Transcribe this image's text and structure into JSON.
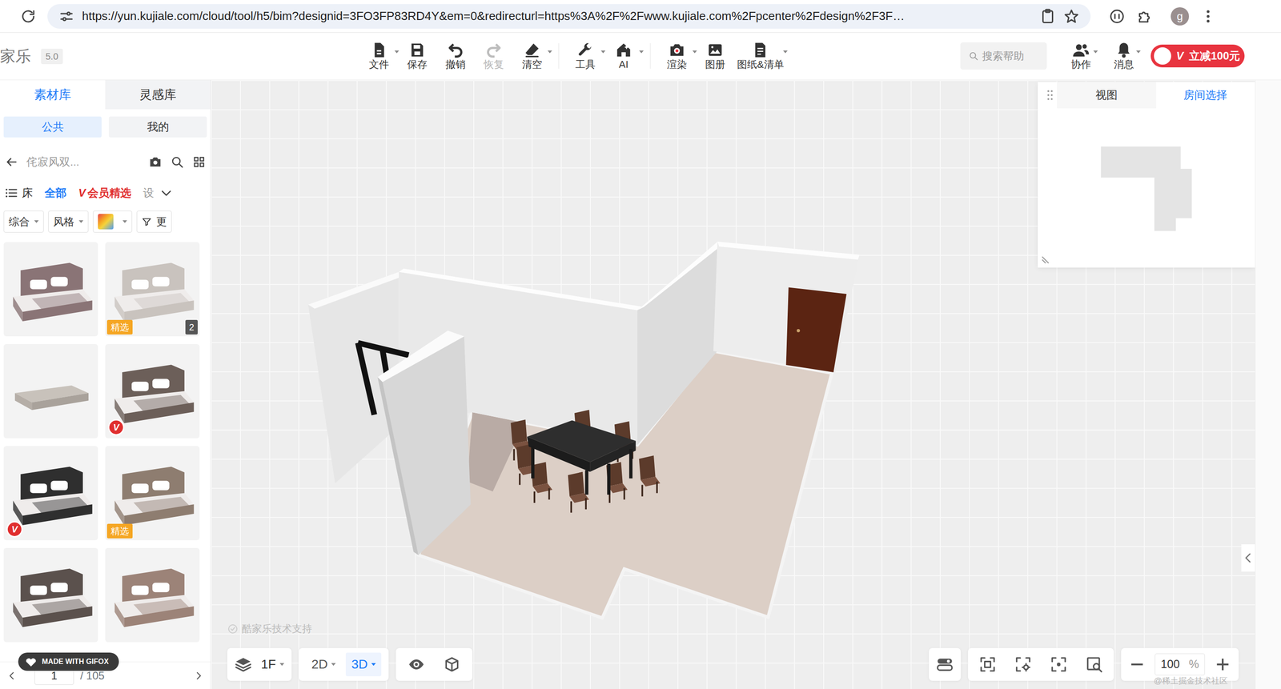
{
  "browser": {
    "url": "https://yun.kujiale.com/cloud/tool/h5/bim?designid=3FO3FP83RD4Y&em=0&redirecturl=https%3A%2F%2Fwww.kujiale.com%2Fpcenter%2Fdesign%2F3F…",
    "profile": "g"
  },
  "app": {
    "logo": "家乐",
    "version": "5.0"
  },
  "toolbar": [
    {
      "label": "文件",
      "disabled": false,
      "menu": true
    },
    {
      "label": "保存",
      "disabled": false,
      "menu": false
    },
    {
      "label": "撤销",
      "disabled": false,
      "menu": false
    },
    {
      "label": "恢复",
      "disabled": true,
      "menu": false
    },
    {
      "label": "清空",
      "disabled": false,
      "menu": true
    },
    {
      "label": "工具",
      "disabled": false,
      "menu": true
    },
    {
      "label": "AI",
      "disabled": false,
      "menu": true
    },
    {
      "label": "渲染",
      "disabled": false,
      "menu": true
    },
    {
      "label": "图册",
      "disabled": false,
      "menu": false
    },
    {
      "label": "图纸&清单",
      "disabled": false,
      "menu": true
    }
  ],
  "search_help": {
    "placeholder": "搜索帮助"
  },
  "toolbar_right": [
    {
      "label": "协作",
      "menu": true
    },
    {
      "label": "消息",
      "menu": true
    }
  ],
  "promo": {
    "badge": "V",
    "label": "立减100元"
  },
  "library": {
    "tabs": [
      {
        "label": "素材库",
        "selected": true
      },
      {
        "label": "灵感库",
        "selected": false
      }
    ],
    "scopes": [
      {
        "label": "公共",
        "selected": true
      },
      {
        "label": "我的",
        "selected": false
      }
    ],
    "search": {
      "value": "侘寂风双..."
    },
    "category": {
      "name": "床",
      "links": [
        {
          "label": "全部",
          "kind": "active",
          "badge": ""
        },
        {
          "label": "会员精选",
          "kind": "vip",
          "badge": "V"
        },
        {
          "label": "设",
          "kind": "plain",
          "badge": ""
        }
      ]
    },
    "filters": [
      {
        "label": "综合",
        "kind": "dropdown"
      },
      {
        "label": "风格",
        "kind": "dropdown"
      },
      {
        "label": "",
        "kind": "color"
      },
      {
        "label": "更",
        "kind": "more"
      }
    ],
    "items": [
      {
        "kind": "bed",
        "color": "#8a7476",
        "badge": "",
        "badge_kind": "none",
        "count": ""
      },
      {
        "kind": "bed",
        "color": "#c9c3be",
        "badge": "精选",
        "badge_kind": "pick",
        "count": "2"
      },
      {
        "kind": "mattress",
        "color": "#c8c2bb",
        "badge": "",
        "badge_kind": "none",
        "count": ""
      },
      {
        "kind": "bed",
        "color": "#6c5f59",
        "badge": "V",
        "badge_kind": "vip",
        "count": ""
      },
      {
        "kind": "bed",
        "color": "#2f2f2f",
        "badge": "V",
        "badge_kind": "vip",
        "count": ""
      },
      {
        "kind": "bed",
        "color": "#8e7d70",
        "badge": "精选",
        "badge_kind": "pick",
        "count": ""
      },
      {
        "kind": "bed",
        "color": "#5b514d",
        "badge": "",
        "badge_kind": "none",
        "count": ""
      },
      {
        "kind": "bed",
        "color": "#9c8378",
        "badge": "",
        "badge_kind": "none",
        "count": ""
      }
    ],
    "pagination": {
      "page": "1",
      "total": "/ 105"
    }
  },
  "gifox": "MADE WITH GIFOX",
  "view_panel": {
    "tabs": [
      {
        "label": "视图",
        "selected": false
      },
      {
        "label": "房间选择",
        "selected": true
      }
    ]
  },
  "bottom_bar": {
    "floor": "1F",
    "modes": [
      {
        "label": "2D",
        "selected": false
      },
      {
        "label": "3D",
        "selected": true
      }
    ],
    "zoom": {
      "value": "100",
      "unit": "%"
    }
  },
  "watermark": "酷家乐技术支持",
  "credit": "@稀土掘金技术社区"
}
